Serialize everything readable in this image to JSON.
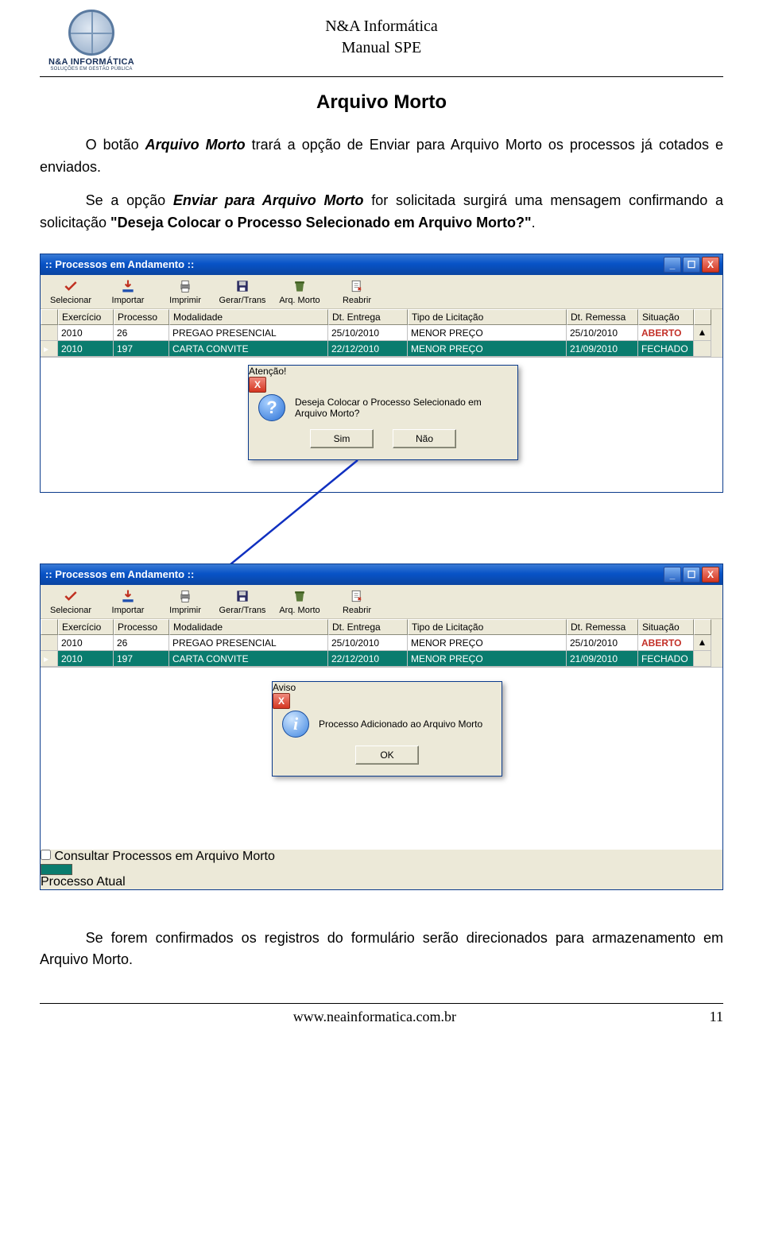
{
  "header": {
    "brand": "N&A INFORMÁTICA",
    "brand_tag": "SOLUÇÕES EM GESTÃO PÚBLICA",
    "line1": "N&A Informática",
    "line2": "Manual SPE"
  },
  "section_title": "Arquivo Morto",
  "para1_a": "O botão ",
  "para1_b": "Arquivo Morto",
  "para1_c": " trará a opção de Enviar para Arquivo Morto os processos já cotados e enviados.",
  "para2_a": "Se a opção ",
  "para2_b": "Enviar para Arquivo Morto",
  "para2_c": " for solicitada surgirá uma mensagem confirmando a solicitação ",
  "para2_d": "\"Deseja Colocar o Processo Selecionado em Arquivo Morto?\"",
  "para2_e": ".",
  "window_title": ":: Processos em Andamento ::",
  "win_buttons": {
    "min": "_",
    "max": "☐",
    "close": "X"
  },
  "toolbar": [
    {
      "icon": "check",
      "label": "Selecionar"
    },
    {
      "icon": "import",
      "label": "Importar"
    },
    {
      "icon": "print",
      "label": "Imprimir"
    },
    {
      "icon": "disk",
      "label": "Gerar/Trans"
    },
    {
      "icon": "trash",
      "label": "Arq. Morto"
    },
    {
      "icon": "reopen",
      "label": "Reabrir"
    }
  ],
  "grid": {
    "headers": [
      "",
      "Exercício",
      "Processo",
      "Modalidade",
      "Dt. Entrega",
      "Tipo de Licitação",
      "Dt. Remessa",
      "Situação",
      ""
    ],
    "rows": [
      {
        "sel": false,
        "g": "",
        "ex": "2010",
        "proc": "26",
        "mod": "PREGAO PRESENCIAL",
        "ent": "25/10/2010",
        "tipo": "MENOR PREÇO",
        "rem": "25/10/2010",
        "sit": "ABERTO"
      },
      {
        "sel": true,
        "g": "▸",
        "ex": "2010",
        "proc": "197",
        "mod": "CARTA CONVITE",
        "ent": "22/12/2010",
        "tipo": "MENOR PREÇO",
        "rem": "21/09/2010",
        "sit": "FECHADO"
      }
    ],
    "scroll_up": "▲"
  },
  "dialog1": {
    "title": "Atenção!",
    "text": "Deseja Colocar o Processo Selecionado em Arquivo Morto?",
    "yes": "Sim",
    "no": "Não",
    "close": "X"
  },
  "dialog2": {
    "title": "Aviso",
    "text": "Processo Adicionado ao Arquivo Morto",
    "ok": "OK",
    "close": "X"
  },
  "bottom": {
    "checkbox_label": "Consultar Processos em Arquivo Morto",
    "legend": "Processo Atual"
  },
  "para3": "Se forem confirmados os registros do formulário serão direcionados para armazenamento em Arquivo Morto.",
  "footer": {
    "url": "www.neainformatica.com.br",
    "page": "11"
  }
}
